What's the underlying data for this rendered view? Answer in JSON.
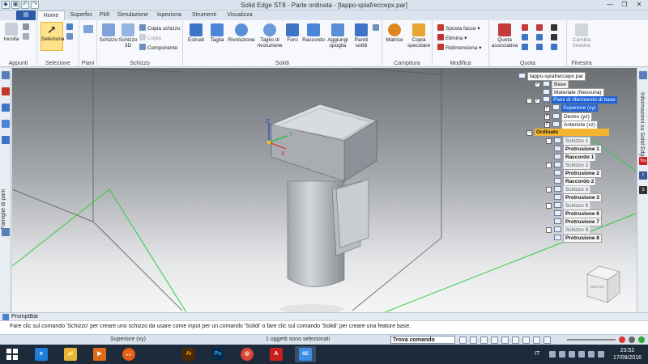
{
  "window": {
    "title": "Solid Edge ST8 - Parte ordinata - [tappo-spiafreccepx.par]",
    "controls": [
      "—",
      "❐",
      "✕"
    ]
  },
  "tabs": [
    "Home",
    "Superfici",
    "PMI",
    "Simulazione",
    "Ispeziona",
    "Strumenti",
    "Visualizza"
  ],
  "ribbon": {
    "groups": {
      "appunti": "Appunti",
      "selezione": "Selezione",
      "piani": "Piani",
      "schizzo": "Schizzo",
      "solidi": "Solidi",
      "campitura": "Campitura",
      "modifica": "Modifica",
      "quota": "Quota",
      "finestra": "Finestra"
    },
    "buttons": {
      "incolla": "Incolla",
      "seleziona": "Seleziona",
      "schizzo": "Schizzo",
      "schizzo3d": "Schizzo 3D",
      "copia_schizzo": "Copia schizzo",
      "copia": "Copia",
      "componente": "Componente",
      "estrudi": "Estrudi",
      "taglia": "Taglia",
      "rivoluzione": "Rivoluzione",
      "taglio_rivoluzione": "Taglio di rivoluzione",
      "foro": "Foro",
      "raccordo": "Raccordo",
      "aggiungi_spoglia": "Aggiungi spoglia",
      "pareti_sottili": "Pareti sottili",
      "matrice": "Matrice",
      "copia_speculare": "Copia speculare",
      "sposta_facce": "Sposta facce",
      "elimina": "Elimina",
      "ridimensiona": "Ridimensiona",
      "quota_associativa": "Quota associativa",
      "cambia_finestra": "Cambia finestra"
    }
  },
  "left_panel": {
    "label": "Famiglie di parti"
  },
  "right_panel": {
    "label": "Informazioni su Solid Edge",
    "social": [
      "You",
      "f",
      "S"
    ]
  },
  "axes": {
    "x": "X",
    "y": "Y",
    "z": "Z"
  },
  "view_cube": "DESTRO",
  "tree": {
    "root": "tappo-spiafreccepx.par",
    "base": "Base",
    "materiale": "Materiale (Nessuna)",
    "piani": "Piani di riferimento di base",
    "superiore": "Superiore (xy)",
    "destro": "Destro (yz)",
    "anteriore": "Anteriore (xz)",
    "ordinato": "Ordinato",
    "items": [
      {
        "type": "sketch",
        "label": "Schizzo 1"
      },
      {
        "type": "feature",
        "label": "Protrusione 1"
      },
      {
        "type": "feature",
        "label": "Raccordo 1"
      },
      {
        "type": "sketch",
        "label": "Schizzo 2"
      },
      {
        "type": "feature",
        "label": "Protrusione 2"
      },
      {
        "type": "feature",
        "label": "Raccordo 2"
      },
      {
        "type": "sketch",
        "label": "Schizzo 3"
      },
      {
        "type": "feature",
        "label": "Protrusione 3"
      },
      {
        "type": "sketch",
        "label": "Schizzo 6"
      },
      {
        "type": "feature",
        "label": "Protrusione 6"
      },
      {
        "type": "feature",
        "label": "Protrusione 7"
      },
      {
        "type": "sketch",
        "label": "Schizzo 9"
      },
      {
        "type": "feature",
        "label": "Protrusione 8"
      }
    ]
  },
  "prompt": {
    "title": "PromptBar",
    "text": "Fare clic sul comando 'Schizzo' per creare uno schizzo da usare come input per un comando 'Solidi' o fare clic sul comando 'Solidi' per creare una feature base."
  },
  "status": {
    "plane": "Superiore (xy)",
    "selection": "1 oggetti sono selezionati",
    "command_placeholder": "Trova comando"
  },
  "taskbar": {
    "apps": [
      "e",
      "📁",
      "▶",
      "🦊",
      "Ai",
      "Ps",
      "◎",
      "A",
      "SE"
    ],
    "lang": "IT",
    "time": "23:52",
    "date": "17/08/2016"
  }
}
